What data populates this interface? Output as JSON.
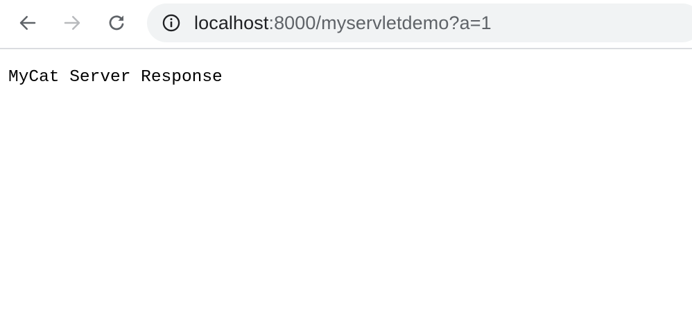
{
  "browser": {
    "back_icon": "arrow-left-icon",
    "forward_icon": "arrow-right-icon",
    "reload_icon": "reload-icon",
    "site_info_icon": "info-circle-icon",
    "url_host": "localhost",
    "url_rest": ":8000/myservletdemo?a=1",
    "colors": {
      "omnibox_bg": "#f1f3f4",
      "active_icon": "#5f6368",
      "disabled_icon": "#b8babd",
      "separator": "#dadce0"
    }
  },
  "page": {
    "body_text": "MyCat Server Response"
  }
}
